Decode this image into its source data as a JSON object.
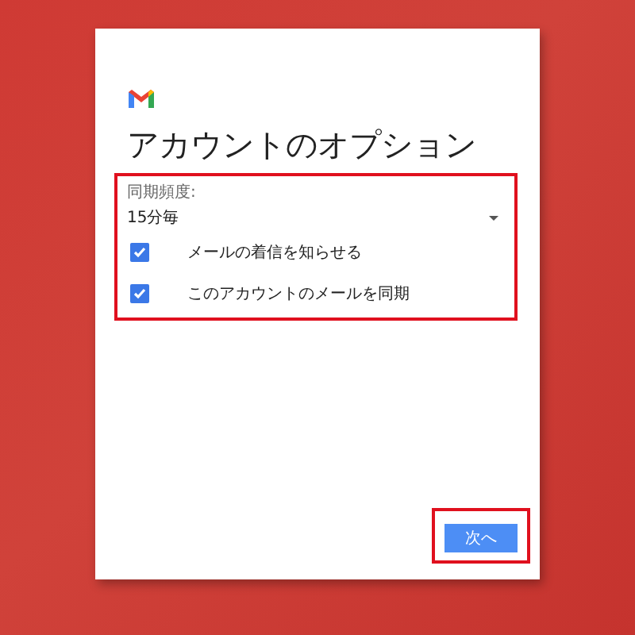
{
  "dialog": {
    "title": "アカウントのオプション",
    "sync_frequency": {
      "label": "同期頻度:",
      "value": "15分毎"
    },
    "options": [
      {
        "label": "メールの着信を知らせる",
        "checked": true
      },
      {
        "label": "このアカウントのメールを同期",
        "checked": true
      }
    ],
    "next_button": "次へ"
  }
}
